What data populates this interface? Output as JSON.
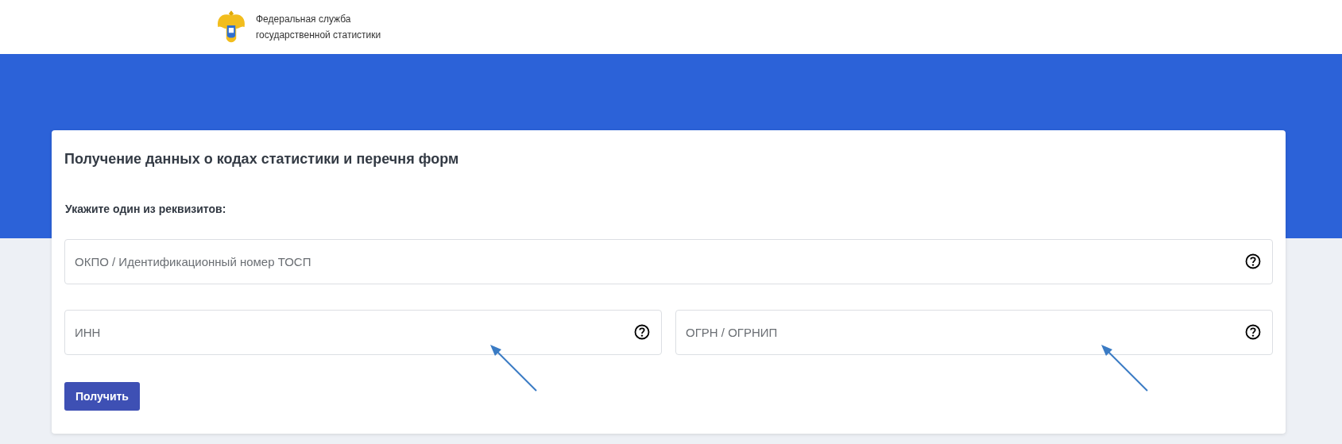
{
  "header": {
    "org_name": [
      "Федеральная служба",
      "государственной статистики"
    ]
  },
  "form": {
    "title": "Получение данных о кодах статистики и перечня форм",
    "subtitle": "Укажите один из реквизитов:",
    "fields": [
      {
        "placeholder": "ОКПО / Идентификационный номер ТОСП",
        "annotated": false
      },
      {
        "placeholder": "ИНН",
        "annotated": true
      },
      {
        "placeholder": "ОГРН / ОГРНИП",
        "annotated": true
      }
    ],
    "submit": "Получить"
  }
}
